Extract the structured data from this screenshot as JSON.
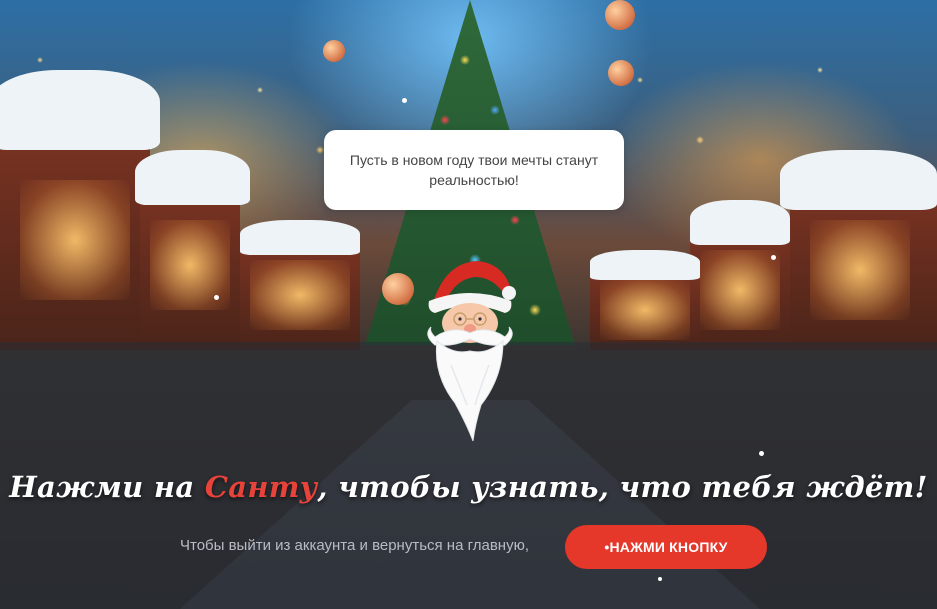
{
  "greeting": {
    "message": "Пусть в новом году твои мечты станут реальностью!"
  },
  "santa": {
    "icon": "santa-icon"
  },
  "headline": {
    "part1": "Нажми на ",
    "accent": "Санту",
    "part2": ", чтобы узнать, что тебя ждёт!"
  },
  "exit": {
    "text": "Чтобы выйти из аккаунта и вернуться на главную,",
    "button_label": "•НАЖМИ КНОПКУ"
  },
  "colors": {
    "accent": "#e8433a",
    "button": "#e5372a",
    "bubble_bg": "#ffffff"
  }
}
